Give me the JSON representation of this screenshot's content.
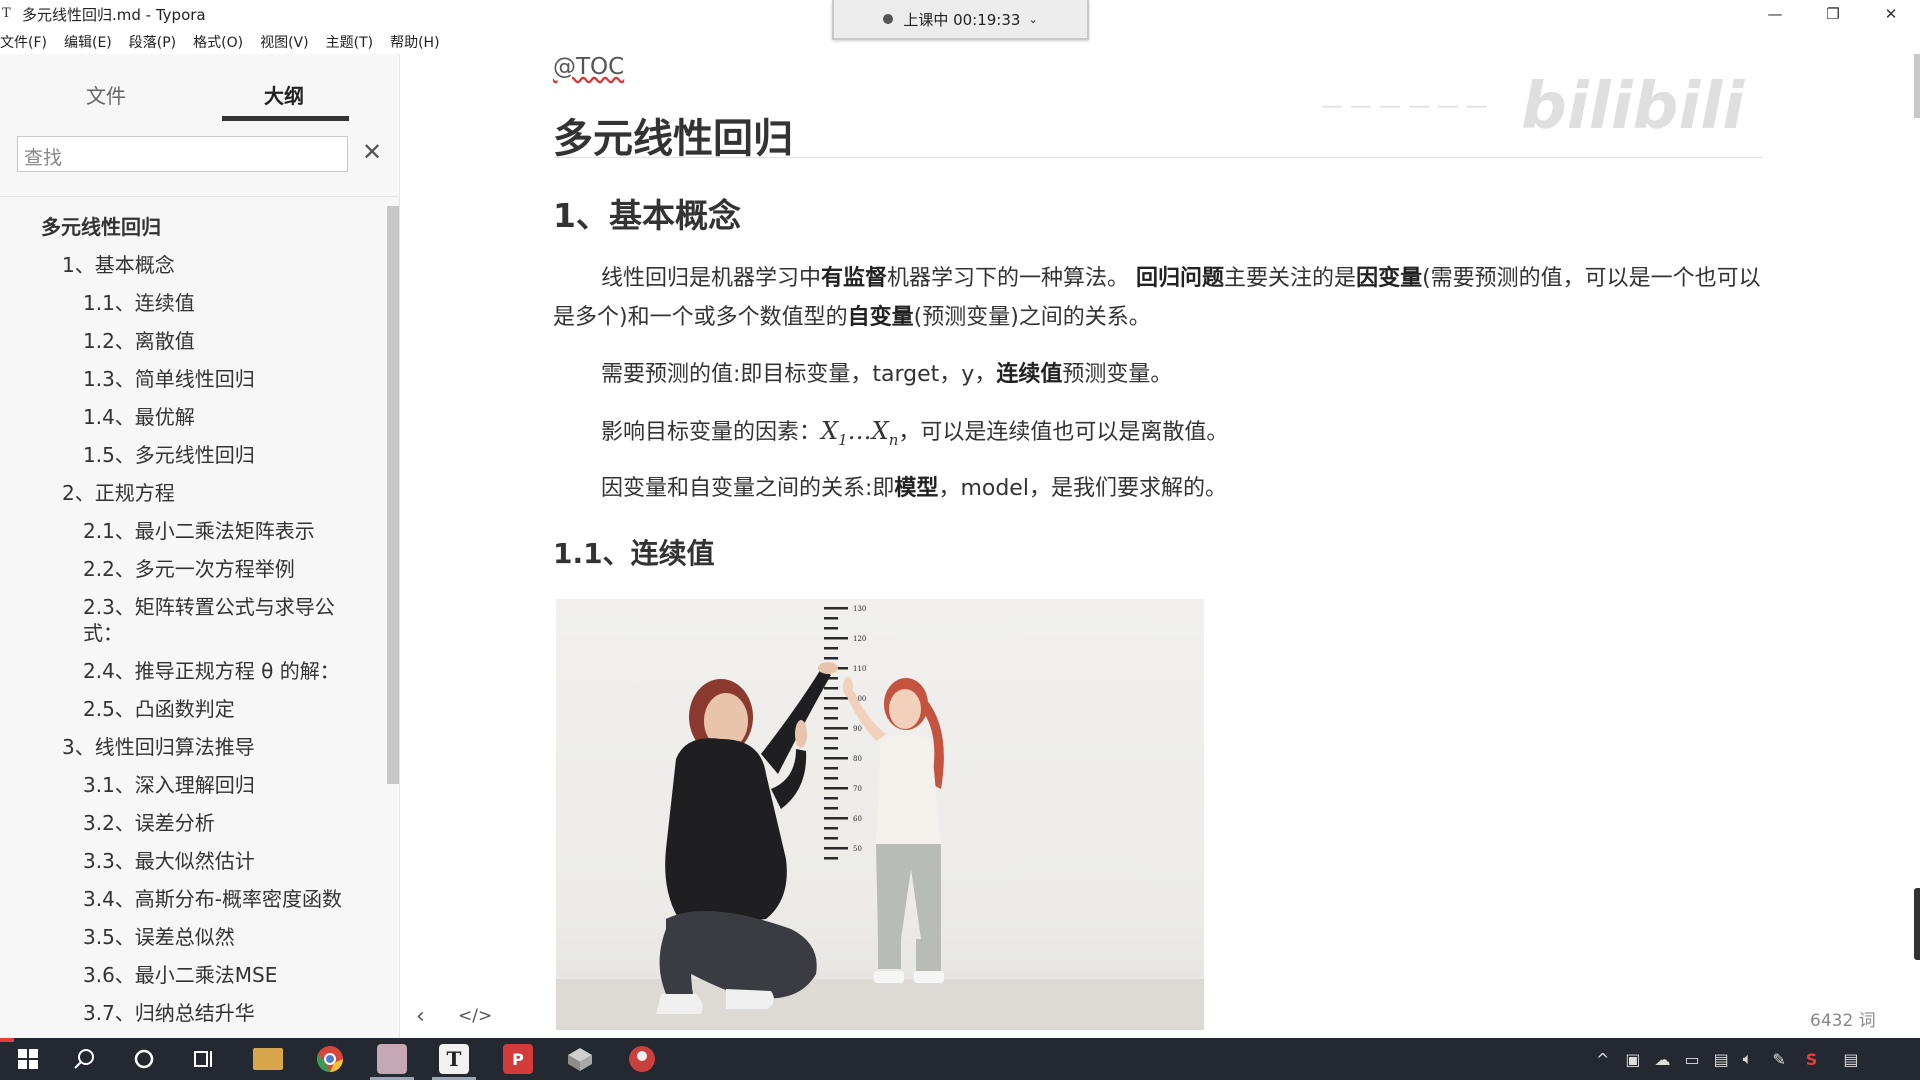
{
  "window": {
    "title": "多元线性回归.md - Typora",
    "app_icon": "T",
    "controls": {
      "minimize": "—",
      "restore": "❐",
      "close": "✕"
    }
  },
  "recording": {
    "status": "上课中 00:19:33"
  },
  "menu": [
    "文件(F)",
    "编辑(E)",
    "段落(P)",
    "格式(O)",
    "视图(V)",
    "主题(T)",
    "帮助(H)"
  ],
  "sidebar": {
    "tabs": [
      "文件",
      "大纲"
    ],
    "search_placeholder": "查找",
    "outline": [
      {
        "label": "多元线性回归",
        "level": 1
      },
      {
        "label": "1、基本概念",
        "level": 2
      },
      {
        "label": "1.1、连续值",
        "level": 3
      },
      {
        "label": "1.2、离散值",
        "level": 3
      },
      {
        "label": "1.3、简单线性回归",
        "level": 3
      },
      {
        "label": "1.4、最优解",
        "level": 3
      },
      {
        "label": "1.5、多元线性回归",
        "level": 3
      },
      {
        "label": "2、正规方程",
        "level": 2
      },
      {
        "label": "2.1、最小二乘法矩阵表示",
        "level": 3
      },
      {
        "label": "2.2、多元一次方程举例",
        "level": 3
      },
      {
        "label": "2.3、矩阵转置公式与求导公式：",
        "level": 3
      },
      {
        "label": "2.4、推导正规方程 θ 的解：",
        "level": 3
      },
      {
        "label": "2.5、凸函数判定",
        "level": 3
      },
      {
        "label": "3、线性回归算法推导",
        "level": 2
      },
      {
        "label": "3.1、深入理解回归",
        "level": 3
      },
      {
        "label": "3.2、误差分析",
        "level": 3
      },
      {
        "label": "3.3、最大似然估计",
        "level": 3
      },
      {
        "label": "3.4、高斯分布-概率密度函数",
        "level": 3
      },
      {
        "label": "3.5、误差总似然",
        "level": 3
      },
      {
        "label": "3.6、最小二乘法MSE",
        "level": 3
      },
      {
        "label": "3.7、归纳总结升华",
        "level": 3
      }
    ]
  },
  "document": {
    "toc_marker": "@TOC",
    "title": "多元线性回归",
    "section1": "1、基本概念",
    "p1": {
      "a": "线性回归是机器学习中",
      "b": "有监督",
      "c": "机器学习下的一种算法。 ",
      "d": "回归问题",
      "e": "主要关注的是",
      "f": "因变量",
      "g": "(需要预测的值，可以是一个也可以是多个)和一个或多个数值型的",
      "h": "自变量",
      "i": "(预测变量)之间的关系。"
    },
    "p2": {
      "a": "需要预测的值:即目标变量，target，y，",
      "b": "连续值",
      "c": "预测变量。"
    },
    "p3": {
      "a": "影响目标变量的因素：",
      "x1": "X",
      "s1": "1",
      "dots": "…",
      "xn": "X",
      "sn": "n",
      "c": "，可以是连续值也可以是离散值。"
    },
    "p4": {
      "a": "因变量和自变量之间的关系:即",
      "b": "模型",
      "c": "，model，是我们要求解的。"
    },
    "section1_1": "1.1、连续值",
    "ruler_labels": [
      "130",
      "120",
      "110",
      "100",
      "90",
      "80",
      "70",
      "60",
      "50"
    ]
  },
  "footer": {
    "back": "‹",
    "source_toggle": "</>",
    "word_count": "6432 词"
  },
  "watermark": "bilibili",
  "taskbar": {
    "apps": [
      "windows-start",
      "search",
      "cortana",
      "task-view",
      "file-explorer",
      "chrome",
      "recorder",
      "typora",
      "pdf",
      "vm",
      "app"
    ],
    "typora_label": "T"
  },
  "colors": {
    "sidebar_bg": "#f7f7f7",
    "taskbar_bg": "#242830",
    "accent_red": "#e83b3b"
  }
}
